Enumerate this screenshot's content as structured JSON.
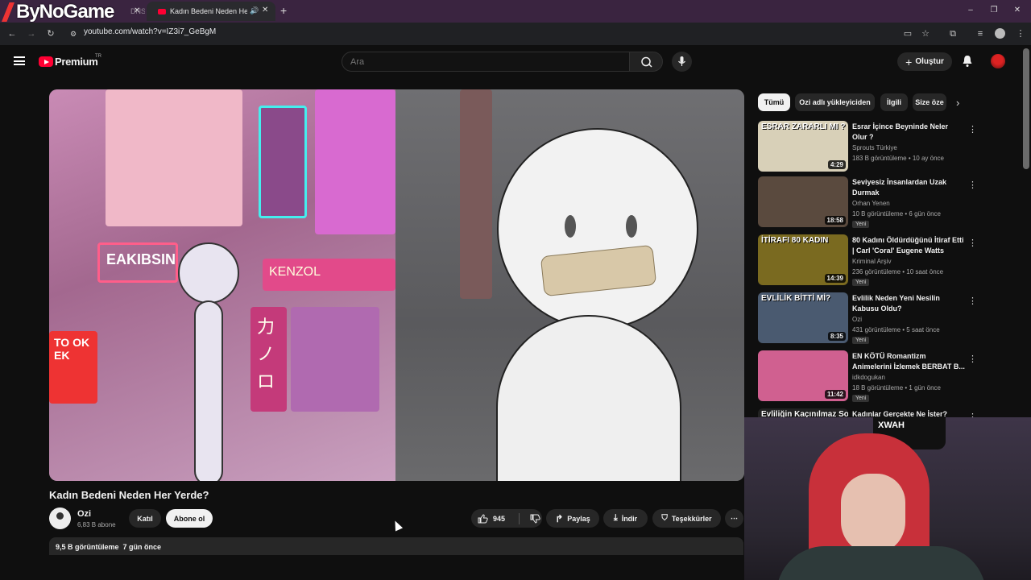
{
  "browser": {
    "watermark": "ByNoGame",
    "tabs": [
      {
        "title": "DNS"
      },
      {
        "title": "Kadın Bedeni Neden Her Yerde"
      }
    ],
    "url": "youtube.com/watch?v=IZ3i7_GeBgM"
  },
  "header": {
    "logo_text": "Premium",
    "region": "TR",
    "search_placeholder": "Ara",
    "create_label": "Oluştur"
  },
  "video": {
    "title": "Kadın Bedeni Neden Her Yerde?",
    "channel": "Ozi",
    "subscribers": "6,83 B abone",
    "join_label": "Katıl",
    "subscribe_label": "Abone ol",
    "likes": "945",
    "share_label": "Paylaş",
    "download_label": "İndir",
    "thanks_label": "Teşekkürler",
    "more_icon": "more-horizontal-icon",
    "views_and_date": "9,5 B görüntüleme  7 gün önce",
    "scene_signs": [
      "EAKIBSIN",
      "KENZOL",
      "TO OK EK",
      "力ノロ"
    ]
  },
  "chips": [
    {
      "label": "Tümü",
      "selected": true
    },
    {
      "label": "Ozi adlı yükleyiciden",
      "selected": false
    },
    {
      "label": "İlgili",
      "selected": false
    },
    {
      "label": "Size öze",
      "selected": false
    }
  ],
  "recommendations": [
    {
      "title": "Esrar İçince Beyninde Neler Olur ?",
      "channel": "Sprouts Türkiye",
      "meta": "183 B görüntüleme • 10 ay önce",
      "duration": "4:29",
      "badge": "",
      "thumb_text": "ESRAR ZARARLI MI ?",
      "thumb_color": "#d8d0b8"
    },
    {
      "title": "Seviyesiz İnsanlardan Uzak Durmak",
      "channel": "Orhan Yenen",
      "meta": "10 B görüntüleme • 6 gün önce",
      "duration": "18:58",
      "badge": "Yeni",
      "thumb_text": "",
      "thumb_color": "#5a4a3e"
    },
    {
      "title": "80 Kadını Öldürdüğünü İtiraf Etti | Carl 'Coral' Eugene Watts",
      "channel": "Kriminal Arşiv",
      "meta": "236 görüntüleme • 10 saat önce",
      "duration": "14:39",
      "badge": "Yeni",
      "thumb_text": "İTİRAFI 80 KADIN",
      "thumb_color": "#7a6a20"
    },
    {
      "title": "Evlilik Neden Yeni Nesilin Kabusu Oldu?",
      "channel": "Ozi",
      "meta": "431 görüntüleme • 5 saat önce",
      "duration": "8:35",
      "badge": "Yeni",
      "thumb_text": "EVLİLİK BİTTİ Mİ?",
      "thumb_color": "#4a5a70"
    },
    {
      "title": "EN KÖTÜ Romantizm Animelerini İzlemek BERBAT B...",
      "channel": "idkdogukan",
      "meta": "18 B görüntüleme • 1 gün önce",
      "duration": "11:42",
      "badge": "Yeni",
      "thumb_text": "",
      "thumb_color": "#d06090"
    },
    {
      "title": "Kadınlar Gerçekte Ne İster?",
      "channel": "",
      "meta": "",
      "duration": "",
      "badge": "",
      "thumb_text": "Evliliğin Kaçınılmaz Sonu...",
      "thumb_color": "#222222"
    }
  ],
  "webcam": {
    "logo_text": "XWAH"
  },
  "colors": {
    "background": "#0f0f0f",
    "brand_red": "#ff0033",
    "tab_strip": "#3a2440"
  }
}
